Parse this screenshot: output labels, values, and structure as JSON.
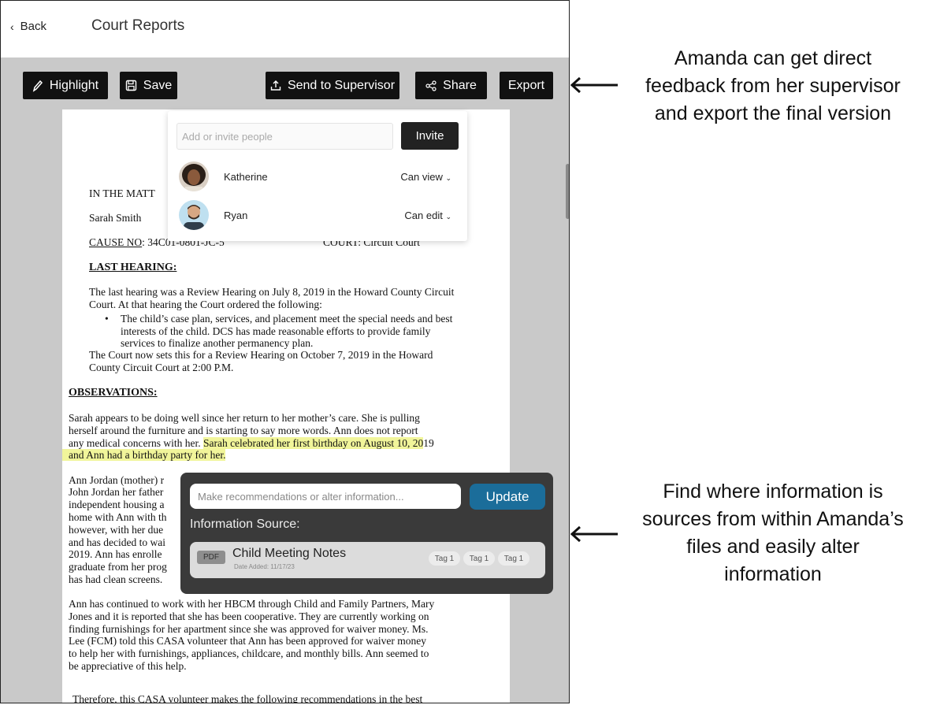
{
  "header": {
    "back_label": "Back",
    "title": "Court Reports"
  },
  "toolbar": {
    "highlight_label": "Highlight",
    "save_label": "Save",
    "send_label": "Send to Supervisor",
    "share_label": "Share",
    "export_label": "Export"
  },
  "share_popup": {
    "placeholder": "Add or invite people",
    "invite_label": "Invite",
    "people": [
      {
        "name": "Katherine",
        "permission": "Can view"
      },
      {
        "name": "Ryan",
        "permission": "Can edit"
      }
    ]
  },
  "document": {
    "matter_prefix": "IN THE MATT",
    "child_name": "Sarah Smith",
    "cause_label": "CAUSE  NO",
    "cause_value": ":  34C01-0801-JC-5",
    "court_label": "COURT:",
    "court_value": "Circuit Court",
    "last_hearing_heading": "LAST   HEARING:",
    "last_hearing_p1_l1": "The last hearing was a Review Hearing on July 8, 2019 in the Howard County Circuit",
    "last_hearing_p1_l2": "Court.  At that hearing the Court ordered the following:",
    "bullet_l1": "The child’s case plan, services, and placement meet the special needs and best",
    "bullet_l2": "interests of the child. DCS has made reasonable efforts to provide family",
    "bullet_l3": "services to finalize another permanency plan.",
    "last_hearing_p2_l1": "The Court now sets this for a Review Hearing on October 7, 2019 in the Howard",
    "last_hearing_p2_l2": "County Circuit Court at 2:00 P.M.",
    "observations_heading": "OBSERVATIONS:",
    "obs_l1": "Sarah appears to be doing well since her return to her mother’s care. She is pulling",
    "obs_l2": "herself around the furniture and is starting to say more words. Ann does not report",
    "obs_l3_plain": "any medical concerns with her. ",
    "obs_l3_hl": "Sarah celebrated her first birthday on August 10, 20",
    "obs_l3_tail": "19",
    "obs_l4_hl": "and Ann had a birthday party for her.",
    "ann_l1": "Ann Jordan (mother) r",
    "ann_l2": "John Jordan her father",
    "ann_l3": "independent housing a",
    "ann_l4": "home with Ann with th",
    "ann_l5": "however, with her due",
    "ann_l6": "and has decided to wai",
    "ann_l7": "2019.  Ann has enrolle",
    "ann_l8": "graduate from her prog",
    "ann_l9": "has had clean screens.",
    "hbcm_l1": "Ann has continued to work with her HBCM through Child and Family Partners, Mary",
    "hbcm_l2": "Jones and it is reported that she has been cooperative. They are currently working on",
    "hbcm_l3": "finding furnishings for her apartment since she was approved for waiver money. Ms.",
    "hbcm_l4": "Lee (FCM) told this CASA volunteer that Ann has been approved for waiver money",
    "hbcm_l5": "to help her with furnishings, appliances, childcare, and monthly bills. Ann seemed to",
    "hbcm_l6": "be appreciative of this help.",
    "therefore_l1": "Therefore, this CASA volunteer makes the following recommendations in the best"
  },
  "info_popup": {
    "placeholder": "Make recommendations or alter information...",
    "update_label": "Update",
    "source_label": "Information Source:",
    "file_type": "PDF",
    "file_name": "Child Meeting Notes",
    "date_added": "Date Added: 11/17/23",
    "tags": [
      "Tag 1",
      "Tag 1",
      "Tag 1"
    ]
  },
  "annotations": {
    "top_l1": "Amanda can get direct",
    "top_l2": "feedback from her supervisor",
    "top_l3": "and export the final version",
    "bottom_l1": "Find where information is",
    "bottom_l2": "sources from within Amanda’s",
    "bottom_l3": "files and easily alter",
    "bottom_l4": "information"
  }
}
